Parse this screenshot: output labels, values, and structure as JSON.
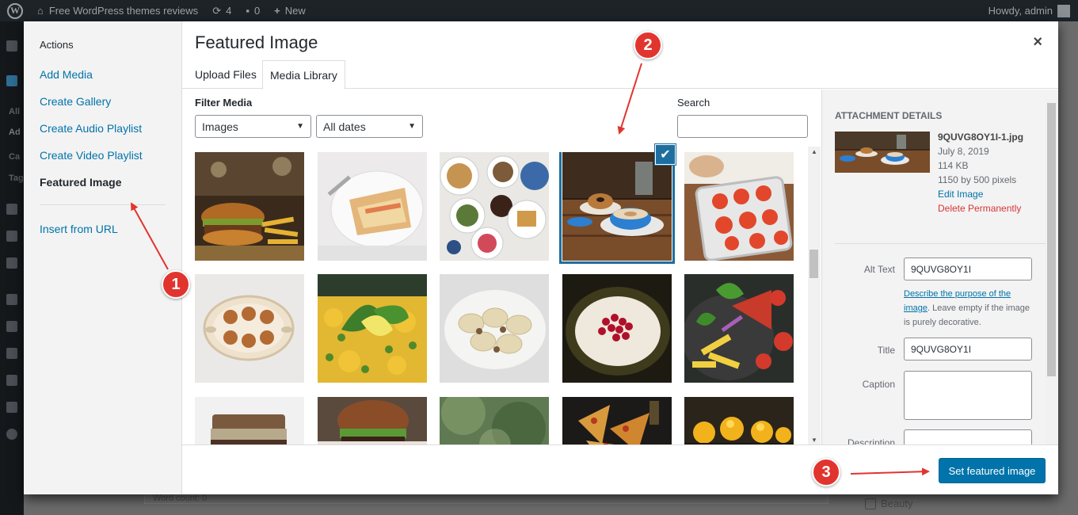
{
  "adminbar": {
    "site_name": "Free WordPress themes reviews",
    "updates_count": "4",
    "comments_count": "0",
    "new_label": "New",
    "howdy": "Howdy, admin"
  },
  "admin_sidebar_fragments": [
    "All",
    "Ad",
    "Ca",
    "Tag"
  ],
  "background": {
    "word_count": "Word count: 0",
    "category_label": "Beauty"
  },
  "media_menu": {
    "heading": "Actions",
    "items": [
      "Add Media",
      "Create Gallery",
      "Create Audio Playlist",
      "Create Video Playlist",
      "Featured Image",
      "Insert from URL"
    ]
  },
  "frame": {
    "title": "Featured Image",
    "close_glyph": "×",
    "tabs": [
      "Upload Files",
      "Media Library"
    ]
  },
  "filters": {
    "label": "Filter Media",
    "type_value": "Images",
    "date_value": "All dates",
    "search_label": "Search",
    "search_value": ""
  },
  "thumbnails": [
    {
      "subject": "burger and fries"
    },
    {
      "subject": "waffle plate"
    },
    {
      "subject": "breakfast spread"
    },
    {
      "subject": "coffee and donut",
      "selected": true
    },
    {
      "subject": "bruschetta tray"
    },
    {
      "subject": "muffin plate"
    },
    {
      "subject": "pea risotto"
    },
    {
      "subject": "ravioli"
    },
    {
      "subject": "rice pudding with berries"
    },
    {
      "subject": "pasta with tomatoes"
    },
    {
      "subject": "steak sandwich"
    },
    {
      "subject": "burger"
    },
    {
      "subject": "green blur"
    },
    {
      "subject": "pizza slices"
    },
    {
      "subject": "yellow pastries"
    }
  ],
  "attachment": {
    "heading": "ATTACHMENT DETAILS",
    "filename": "9QUVG8OY1I-1.jpg",
    "date": "July 8, 2019",
    "size": "114 KB",
    "dimensions": "1150 by 500 pixels",
    "edit_label": "Edit Image",
    "delete_label": "Delete Permanently",
    "alt_label": "Alt Text",
    "alt_value": "9QUVG8OY1I",
    "alt_help_link": "Describe the purpose of the image",
    "alt_help_rest": ". Leave empty if the image is purely decorative.",
    "title_label": "Title",
    "title_value": "9QUVG8OY1I",
    "caption_label": "Caption",
    "description_label": "Description"
  },
  "toolbar": {
    "primary_label": "Set featured image"
  },
  "annotations": [
    "1",
    "2",
    "3"
  ],
  "colors": {
    "accent": "#0073aa",
    "selected_border": "#1e6f9f",
    "delete": "#d63638",
    "annotation": "#e2342e"
  }
}
